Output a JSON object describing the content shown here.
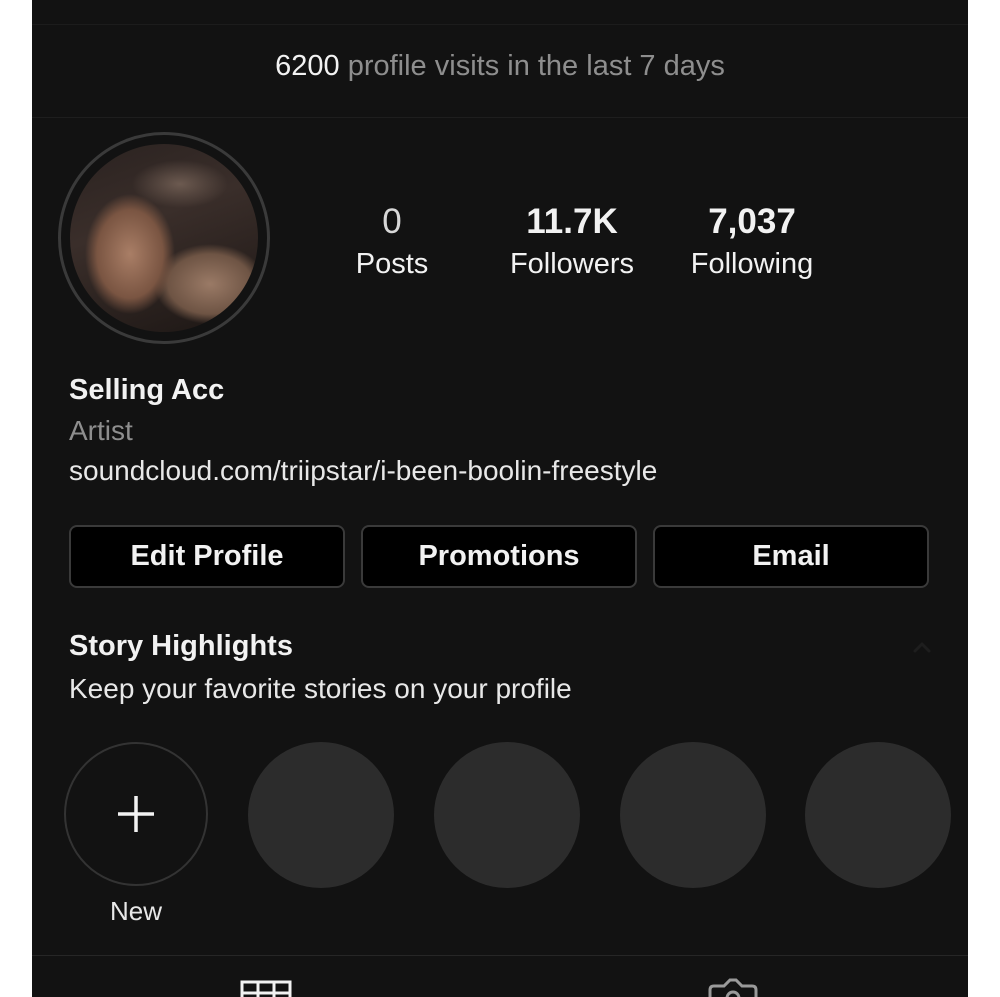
{
  "visits": {
    "count": "6200",
    "text": "profile visits in the last 7 days"
  },
  "stats": [
    {
      "value": "0",
      "label": "Posts"
    },
    {
      "value": "11.7K",
      "label": "Followers"
    },
    {
      "value": "7,037",
      "label": "Following"
    }
  ],
  "profile": {
    "name": "Selling Acc",
    "category": "Artist",
    "link": "soundcloud.com/triipstar/i-been-boolin-freestyle"
  },
  "buttons": {
    "edit": "Edit Profile",
    "promotions": "Promotions",
    "email": "Email"
  },
  "highlights": {
    "title": "Story Highlights",
    "subtitle": "Keep your favorite stories on your profile",
    "new_label": "New"
  },
  "icons": {
    "collapse": "chevron-up-icon",
    "add": "plus-icon",
    "grid_tab": "grid-icon",
    "tagged_tab": "tagged-icon"
  },
  "colors": {
    "background": "#121212",
    "button_bg": "#000000",
    "muted_text": "#8e8e8e",
    "highlight_placeholder": "#2c2c2c"
  }
}
